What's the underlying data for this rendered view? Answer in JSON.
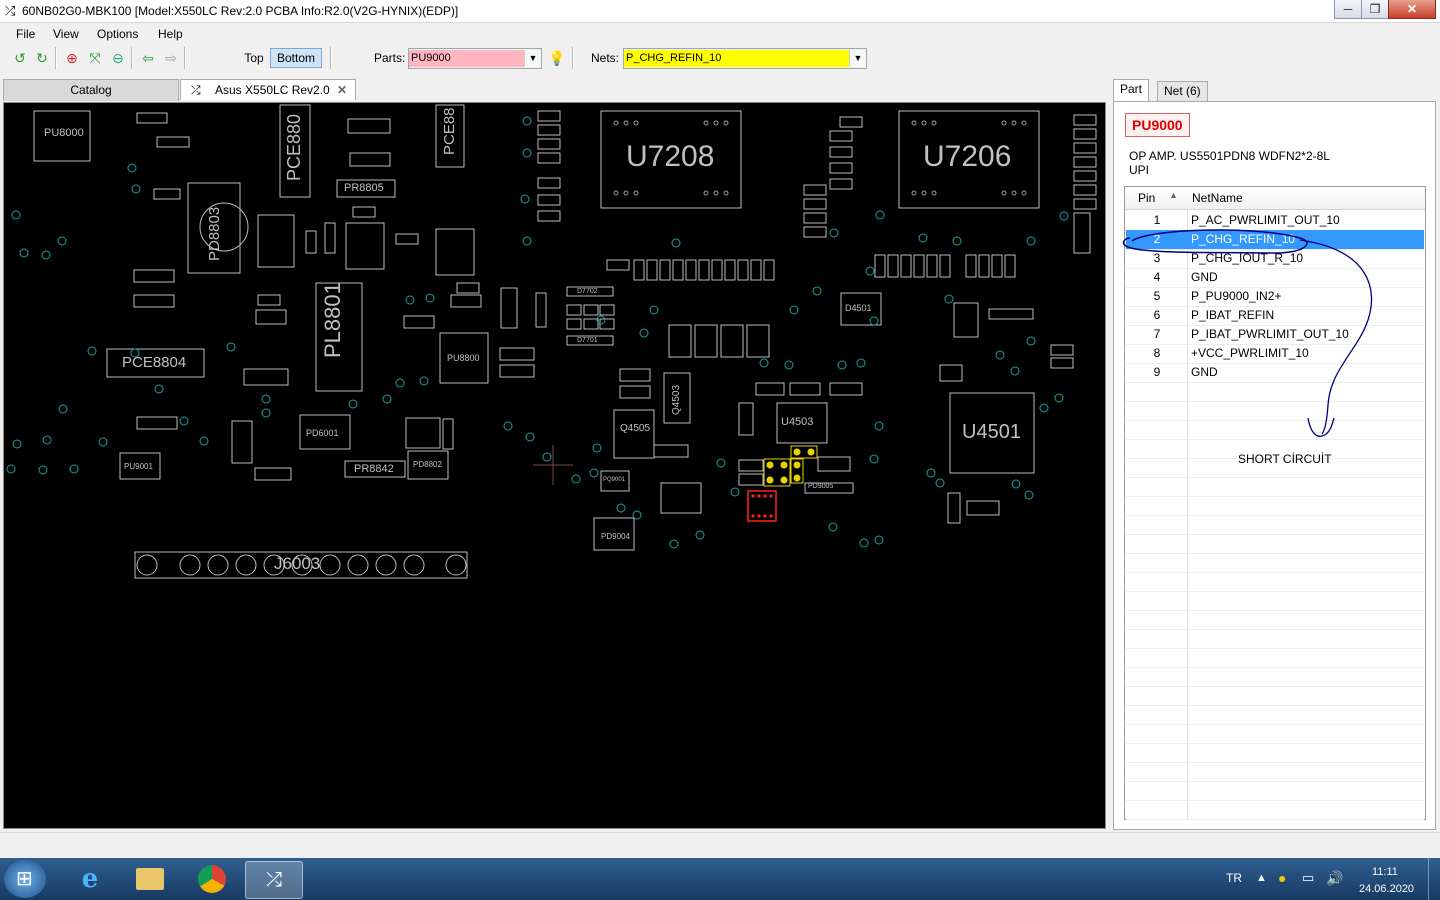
{
  "window": {
    "title": "60NB02G0-MBK100 [Model:X550LC Rev:2.0 PCBA Info:R2.0(V2G-HYNIX)(EDP)]",
    "app_icon": "shuffle-icon"
  },
  "menu": [
    "File",
    "View",
    "Options",
    "Help"
  ],
  "toolbar": {
    "top_label": "Top",
    "bottom_label": "Bottom",
    "parts_label": "Parts:",
    "parts_value": "PU9000",
    "nets_label": "Nets:",
    "nets_value": "P_CHG_REFIN_10",
    "parts_color": "#ffb6c1",
    "nets_color": "#ffff00"
  },
  "tabs": {
    "catalog": "Catalog",
    "board": "Asus X550LC Rev2.0"
  },
  "board_labels": {
    "u7208": "U7208",
    "u7206": "U7206",
    "u4501": "U4501",
    "pl8801": "PL8801",
    "pce8804": "PCE8804",
    "pd8803": "PD8803",
    "j6003": "J6003",
    "pce880": "PCE880",
    "pce88": "PCE88",
    "pu8000": "PU8000",
    "pr8805": "PR8805",
    "pr8842": "PR8842",
    "q4505": "Q4505",
    "q4503": "Q4503",
    "u4503": "U4503",
    "pd6001": "PD6001",
    "pu9001": "PU9001",
    "pq9001": "PQ9001",
    "pd9004": "PD9004",
    "pd9005": "PD9005",
    "d4501": "D4501",
    "d7702": "D7702",
    "d7701": "D7701",
    "pu8800": "PU8800",
    "pd8802": "PD8802"
  },
  "panel": {
    "tab_part": "Part",
    "tab_net": "Net (6)",
    "part_name": "PU9000",
    "description_line1": "OP AMP. US5501PDN8 WDFN2*2-8L",
    "description_line2": "UPI",
    "col_pin": "Pin",
    "col_netname": "NetName",
    "pins": [
      {
        "pin": "1",
        "net": "P_AC_PWRLIMIT_OUT_10"
      },
      {
        "pin": "2",
        "net": "P_CHG_REFIN_10"
      },
      {
        "pin": "3",
        "net": "P_CHG_IOUT_R_10"
      },
      {
        "pin": "4",
        "net": "GND"
      },
      {
        "pin": "5",
        "net": "P_PU9000_IN2+"
      },
      {
        "pin": "6",
        "net": "P_IBAT_REFIN"
      },
      {
        "pin": "7",
        "net": "P_IBAT_PWRLIMIT_OUT_10"
      },
      {
        "pin": "8",
        "net": "+VCC_PWRLIMIT_10"
      },
      {
        "pin": "9",
        "net": "GND"
      }
    ],
    "selected_pin": "2",
    "annotation": "SHORT CİRCUİT"
  },
  "taskbar": {
    "lang": "TR",
    "time": "11:11",
    "date": "24.06.2020"
  }
}
